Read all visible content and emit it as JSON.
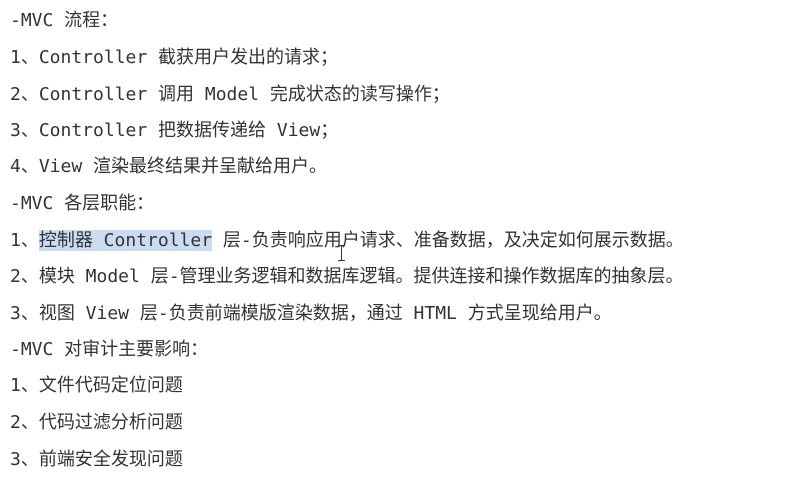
{
  "sections": [
    {
      "heading": "-MVC 流程：",
      "items": [
        "1、Controller 截获用户发出的请求；",
        "2、Controller 调用 Model 完成状态的读写操作；",
        "3、Controller 把数据传递给 View；",
        "4、View 渲染最终结果并呈献给用户。"
      ]
    },
    {
      "heading": "-MVC 各层职能：",
      "items": [
        {
          "prefix": "1、",
          "highlight": "控制器 Controller",
          "rest": " 层-负责响应用户请求、准备数据，及决定如何展示数据。"
        },
        "2、模块 Model 层-管理业务逻辑和数据库逻辑。提供连接和操作数据库的抽象层。",
        "3、视图 View 层-负责前端模版渲染数据，通过 HTML 方式呈现给用户。"
      ]
    },
    {
      "heading": "-MVC 对审计主要影响：",
      "items": [
        "1、文件代码定位问题",
        "2、代码过滤分析问题",
        "3、前端安全发现问题"
      ]
    }
  ]
}
